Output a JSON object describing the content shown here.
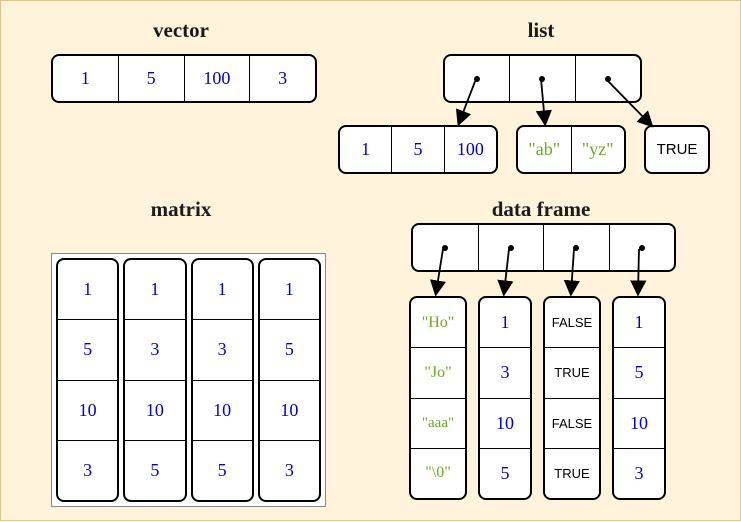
{
  "titles": {
    "vector": "vector",
    "list": "list",
    "matrix": "matrix",
    "dataframe": "data frame"
  },
  "vector": [
    "1",
    "5",
    "100",
    "3"
  ],
  "list": {
    "child_numeric": [
      "1",
      "5",
      "100"
    ],
    "child_string": [
      "\"ab\"",
      "\"yz\""
    ],
    "child_logical": [
      "TRUE"
    ]
  },
  "matrix": [
    [
      "1",
      "5",
      "10",
      "3"
    ],
    [
      "1",
      "3",
      "10",
      "5"
    ],
    [
      "1",
      "3",
      "10",
      "5"
    ],
    [
      "1",
      "5",
      "10",
      "3"
    ]
  ],
  "dataframe": {
    "col_string": [
      "\"Ho\"",
      "\"Jo\"",
      "\"aaa\"",
      "\"\\0\""
    ],
    "col_num1": [
      "1",
      "3",
      "10",
      "5"
    ],
    "col_logical": [
      "FALSE",
      "TRUE",
      "FALSE",
      "TRUE"
    ],
    "col_num2": [
      "1",
      "5",
      "10",
      "3"
    ]
  },
  "chart_data": {
    "type": "table",
    "title": "R data structures: vector, list, matrix, data frame",
    "structures": {
      "vector": {
        "type": "numeric",
        "values": [
          1,
          5,
          100,
          3
        ]
      },
      "list": {
        "elements": [
          {
            "type": "numeric",
            "values": [
              1,
              5,
              100
            ]
          },
          {
            "type": "character",
            "values": [
              "ab",
              "yz"
            ]
          },
          {
            "type": "logical",
            "values": [
              true
            ]
          }
        ]
      },
      "matrix": {
        "type": "numeric",
        "columns": [
          [
            1,
            5,
            10,
            3
          ],
          [
            1,
            3,
            10,
            5
          ],
          [
            1,
            3,
            10,
            5
          ],
          [
            1,
            5,
            10,
            3
          ]
        ]
      },
      "data_frame": {
        "columns": [
          {
            "type": "character",
            "values": [
              "Ho",
              "Jo",
              "aaa",
              "\\0"
            ]
          },
          {
            "type": "numeric",
            "values": [
              1,
              3,
              10,
              5
            ]
          },
          {
            "type": "logical",
            "values": [
              false,
              true,
              false,
              true
            ]
          },
          {
            "type": "numeric",
            "values": [
              1,
              5,
              10,
              3
            ]
          }
        ]
      }
    }
  }
}
